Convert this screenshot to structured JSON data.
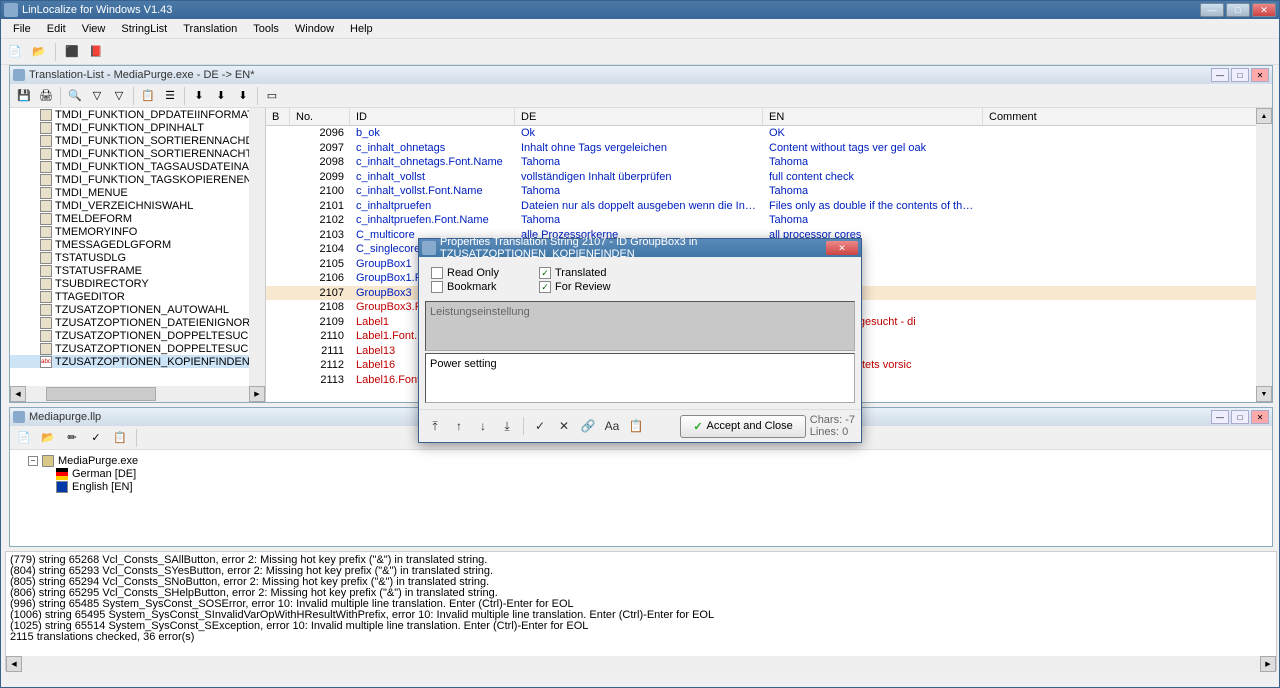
{
  "app": {
    "title": "LinLocalize for Windows V1.43"
  },
  "menus": {
    "file": "File",
    "edit": "Edit",
    "view": "View",
    "stringlist": "StringList",
    "translation": "Translation",
    "tools": "Tools",
    "window": "Window",
    "help": "Help"
  },
  "doc_window": {
    "title": "Translation-List - MediaPurge.exe - DE -> EN*"
  },
  "tree_items": [
    "TMDI_FUNKTION_DPDATEIINFORMATIONEN",
    "TMDI_FUNKTION_DPINHALT",
    "TMDI_FUNKTION_SORTIERENNACHDATEINAMEN",
    "TMDI_FUNKTION_SORTIERENNACHTAGS",
    "TMDI_FUNKTION_TAGSAUSDATEINAMEN",
    "TMDI_FUNKTION_TAGSKOPIERENENTFERNEN",
    "TMDI_MENUE",
    "TMDI_VERZEICHNISWAHL",
    "TMELDEFORM",
    "TMEMORYINFO",
    "TMESSAGEDLGFORM",
    "TSTATUSDLG",
    "TSTATUSFRAME",
    "TSUBDIRECTORY",
    "TTAGEDITOR",
    "TZUSATZOPTIONEN_AUTOWAHL",
    "TZUSATZOPTIONEN_DATEIENIGNORIEREN",
    "TZUSATZOPTIONEN_DOPPELTESUCHENAEHNLIC",
    "TZUSATZOPTIONEN_DOPPELTESUCHENAFP",
    "TZUSATZOPTIONEN_KOPIENFINDEN"
  ],
  "tree_selected_index": 19,
  "table": {
    "headers": {
      "b": "B",
      "no": "No.",
      "id": "ID",
      "de": "DE",
      "en": "EN",
      "comment": "Comment"
    },
    "rows": [
      {
        "no": "2096",
        "id": "b_ok",
        "de": "Ok",
        "en": "OK"
      },
      {
        "no": "2097",
        "id": "c_inhalt_ohnetags",
        "de": "Inhalt ohne Tags vergeleichen",
        "en": "Content without tags ver gel oak"
      },
      {
        "no": "2098",
        "id": "c_inhalt_ohnetags.Font.Name",
        "de": "Tahoma",
        "en": "Tahoma"
      },
      {
        "no": "2099",
        "id": "c_inhalt_vollst",
        "de": "vollständigen Inhalt überprüfen",
        "en": "full content check"
      },
      {
        "no": "2100",
        "id": "c_inhalt_vollst.Font.Name",
        "de": "Tahoma",
        "en": "Tahoma"
      },
      {
        "no": "2101",
        "id": "c_inhaltpruefen",
        "de": "Dateien nur als doppelt ausgeben wenn die Inhalte der Dateien",
        "en": "Files only as double if the contents of the files are identi"
      },
      {
        "no": "2102",
        "id": "c_inhaltpruefen.Font.Name",
        "de": "Tahoma",
        "en": "Tahoma"
      },
      {
        "no": "2103",
        "id": "C_multicore",
        "de": "alle Prozessorkerne",
        "en": "all processor cores"
      },
      {
        "no": "2104",
        "id": "C_singlecore",
        "de": "",
        "en": ""
      },
      {
        "no": "2105",
        "id": "GroupBox1",
        "de": "",
        "en": ""
      },
      {
        "no": "2106",
        "id": "GroupBox1.Fon",
        "de": "",
        "en": ""
      },
      {
        "no": "2107",
        "id": "GroupBox3",
        "de": "",
        "en": "",
        "selected": true
      },
      {
        "no": "2108",
        "id": "GroupBox3.Fon",
        "de": "",
        "en": "",
        "red": true
      },
      {
        "no": "2109",
        "id": "Label1",
        "de": "",
        "en": "ischer Dateigröße gesucht - di",
        "red": true,
        "enRed": true
      },
      {
        "no": "2110",
        "id": "Label1.Font.Na",
        "de": "",
        "en": "",
        "red": true
      },
      {
        "no": "2111",
        "id": "Label13",
        "de": "",
        "en": "",
        "red": true
      },
      {
        "no": "2112",
        "id": "Label16",
        "de": "",
        "en": "ungen sollten Sie stets vorsic",
        "red": true,
        "enRed": true
      },
      {
        "no": "2113",
        "id": "Label16.Font.N",
        "de": "",
        "en": "",
        "red": true
      }
    ]
  },
  "project_window": {
    "title": "Mediapurge.llp",
    "root": "MediaPurge.exe",
    "langs": [
      {
        "icon": "flag-de",
        "label": "German  [DE]"
      },
      {
        "icon": "flag-en",
        "label": "English  [EN]"
      }
    ]
  },
  "log_lines": [
    "(779) string 65268 Vcl_Consts_SAllButton, error 2: Missing hot key prefix (\"&\") in translated string.",
    "(804) string 65293 Vcl_Consts_SYesButton, error 2: Missing hot key prefix (\"&\") in translated string.",
    "(805) string 65294 Vcl_Consts_SNoButton, error 2: Missing hot key prefix (\"&\") in translated string.",
    "(806) string 65295 Vcl_Consts_SHelpButton, error 2: Missing hot key prefix (\"&\") in translated string.",
    "(996) string 65485 System_SysConst_SOSError, error 10: Invalid multiple line translation. Enter (Ctrl)-Enter for EOL",
    "(1006) string 65495 System_SysConst_SInvalidVarOpWithHResultWithPrefix, error 10: Invalid multiple line translation. Enter (Ctrl)-Enter for EOL",
    "(1025) string 65514 System_SysConst_SException, error 10: Invalid multiple line translation. Enter (Ctrl)-Enter for EOL",
    "2115 translations checked, 36 error(s)"
  ],
  "dialog": {
    "title": "Properties Translation String 2107 - ID GroupBox3 in TZUSATZOPTIONEN_KOPIENFINDEN",
    "readonly_label": "Read Only",
    "bookmark_label": "Bookmark",
    "translated_label": "Translated",
    "forreview_label": "For Review",
    "translated_checked": true,
    "forreview_checked": true,
    "source_text": "Leistungseinstellung",
    "target_text": "Power setting",
    "accept_label": "Accept and Close",
    "stats_chars": "Chars: -7",
    "stats_lines": "Lines: 0"
  }
}
